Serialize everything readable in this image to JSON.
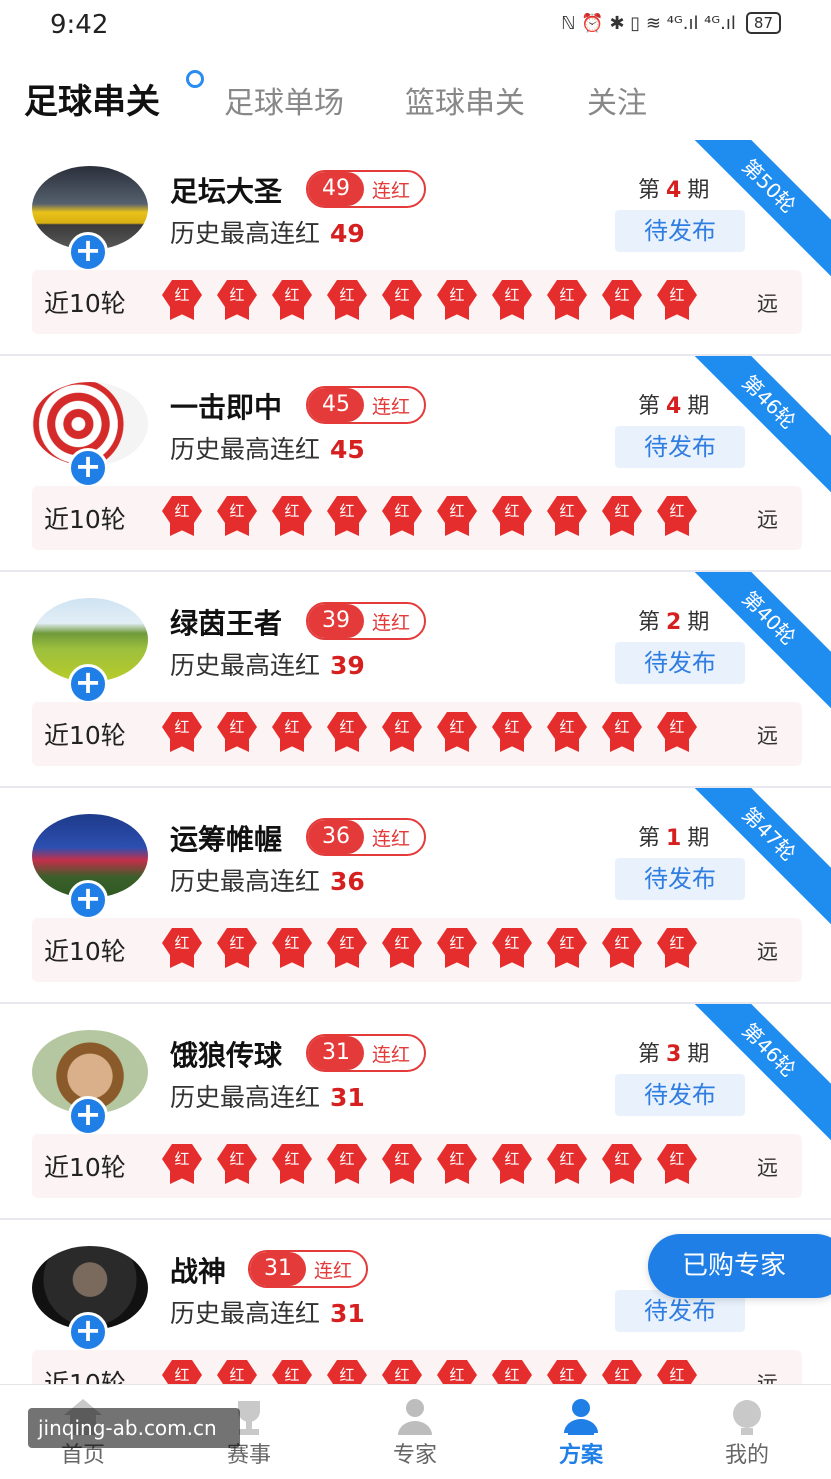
{
  "status_bar": {
    "time": "9:42",
    "icons": "ℕ ⏰ ✱ ▯ ≋ ⁴ᴳ.ıl ⁴ᴳ.ıl",
    "battery": "87"
  },
  "tabs": [
    {
      "label": "足球串关",
      "active": true
    },
    {
      "label": "足球单场",
      "active": false
    },
    {
      "label": "篮球串关",
      "active": false
    },
    {
      "label": "关注",
      "active": false
    }
  ],
  "common": {
    "streak_suffix": "连红",
    "history_label": "历史最高连红",
    "recent_label": "近10轮",
    "badge_text": "红",
    "far_label": "远",
    "period_prefix": "第",
    "period_suffix": "期",
    "pending_label": "待发布"
  },
  "experts": [
    {
      "name": "足坛大圣",
      "streak": "49",
      "best": "49",
      "period": "4",
      "ribbon": "第50轮",
      "avatar": "sports-car",
      "recent": [
        "红",
        "红",
        "红",
        "红",
        "红",
        "红",
        "红",
        "红",
        "红",
        "红"
      ]
    },
    {
      "name": "一击即中",
      "streak": "45",
      "best": "45",
      "period": "4",
      "ribbon": "第46轮",
      "avatar": "dart-target",
      "recent": [
        "红",
        "红",
        "红",
        "红",
        "红",
        "红",
        "红",
        "红",
        "红",
        "红"
      ]
    },
    {
      "name": "绿茵王者",
      "streak": "39",
      "best": "39",
      "period": "2",
      "ribbon": "第40轮",
      "avatar": "green-field",
      "recent": [
        "红",
        "红",
        "红",
        "红",
        "红",
        "红",
        "红",
        "红",
        "红",
        "红"
      ]
    },
    {
      "name": "运筹帷幄",
      "streak": "36",
      "best": "36",
      "period": "1",
      "ribbon": "第47轮",
      "avatar": "football-player",
      "recent": [
        "红",
        "红",
        "红",
        "红",
        "红",
        "红",
        "红",
        "红",
        "红",
        "红"
      ]
    },
    {
      "name": "饿狼传球",
      "streak": "31",
      "best": "31",
      "period": "3",
      "ribbon": "第46轮",
      "avatar": "cartoon-face",
      "recent": [
        "红",
        "红",
        "红",
        "红",
        "红",
        "红",
        "红",
        "红",
        "红",
        "红"
      ]
    },
    {
      "name": "战神",
      "streak": "31",
      "best": "31",
      "period": "",
      "ribbon": "",
      "avatar": "man-portrait",
      "recent": [
        "红",
        "红",
        "红",
        "红",
        "红",
        "红",
        "红",
        "红",
        "红",
        "红"
      ]
    }
  ],
  "float_button": "已购专家",
  "bottom_nav": [
    {
      "label": "首页",
      "icon": "home-icon",
      "active": false
    },
    {
      "label": "赛事",
      "icon": "trophy-icon",
      "active": false
    },
    {
      "label": "专家",
      "icon": "expert-icon",
      "active": false
    },
    {
      "label": "方案",
      "icon": "plan-icon",
      "active": true
    },
    {
      "label": "我的",
      "icon": "profile-icon",
      "active": false
    }
  ],
  "watermark": "jinqing-ab.com.cn",
  "colors": {
    "accent": "#1f7fe6",
    "red": "#e43a3a"
  }
}
